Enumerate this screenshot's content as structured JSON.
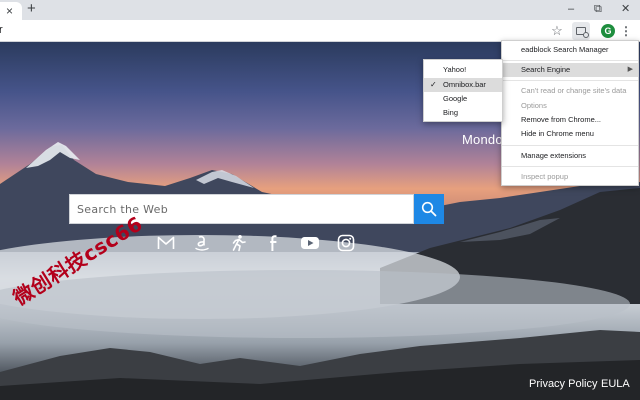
{
  "browser": {
    "tab": {
      "close_glyph": "×"
    },
    "new_tab_glyph": "+",
    "window_controls": {
      "minimize": "–",
      "restore": "⧉",
      "close": "✕"
    },
    "omnibox_text": "r",
    "avatar_letter": "G",
    "menu_glyph": "⋮",
    "icons": [
      "close-icon",
      "plus-icon",
      "star-icon",
      "extension-icon",
      "avatar",
      "kebab-menu-icon"
    ]
  },
  "page": {
    "search": {
      "placeholder": "Search the Web"
    },
    "brand_text": "Mondo",
    "quick_links": [
      {
        "name": "gmail",
        "icon": "gmail-icon"
      },
      {
        "name": "amazon",
        "icon": "amazon-icon"
      },
      {
        "name": "fitness",
        "icon": "runner-icon"
      },
      {
        "name": "facebook",
        "icon": "facebook-icon"
      },
      {
        "name": "youtube",
        "icon": "youtube-icon"
      },
      {
        "name": "instagram",
        "icon": "instagram-icon"
      }
    ],
    "footer": {
      "privacy": "Privacy Policy",
      "eula": "EULA"
    },
    "watermark": "微创科技csc66"
  },
  "context_menu": {
    "title": "eadblock Search Manager",
    "search_engine": "Search Engine",
    "cant_read": "Can't read or change site's data",
    "options": "Options",
    "remove": "Remove from Chrome...",
    "hide": "Hide in Chrome menu",
    "manage": "Manage extensions",
    "inspect": "Inspect popup"
  },
  "search_engine_submenu": {
    "items": [
      "Yahoo!",
      "Omnibox.bar",
      "Google",
      "Bing"
    ],
    "selected": "Omnibox.bar",
    "check_glyph": "✓"
  },
  "colors": {
    "accent": "#1e88e5",
    "watermark": "#b3001b",
    "menu_highlight": "#dcdcdc"
  }
}
